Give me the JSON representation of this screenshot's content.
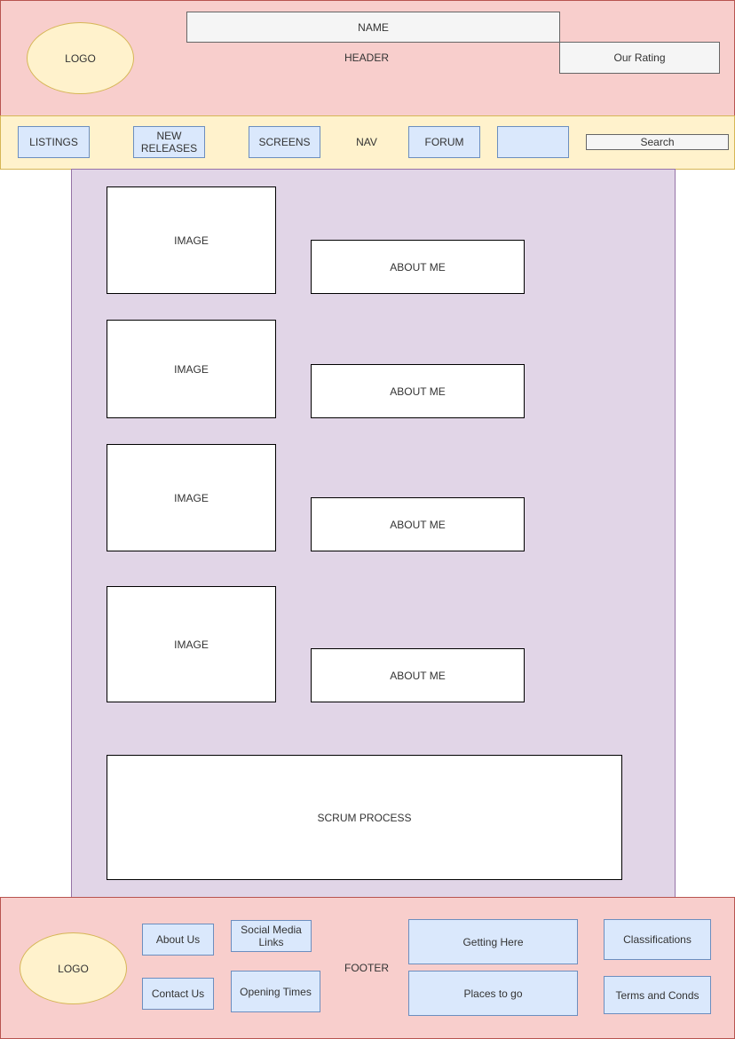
{
  "header": {
    "label": "HEADER",
    "logo": "LOGO",
    "name": "NAME",
    "rating": "Our Rating"
  },
  "nav": {
    "label": "NAV",
    "items": [
      "LISTINGS",
      "NEW\nRELEASES",
      "SCREENS",
      "FORUM",
      ""
    ],
    "search": "Search"
  },
  "main": {
    "rows": [
      {
        "image": "IMAGE",
        "about": "ABOUT ME"
      },
      {
        "image": "IMAGE",
        "about": "ABOUT ME"
      },
      {
        "image": "IMAGE",
        "about": "ABOUT ME"
      },
      {
        "image": "IMAGE",
        "about": "ABOUT ME"
      }
    ],
    "scrum": "SCRUM PROCESS"
  },
  "footer": {
    "label": "FOOTER",
    "logo": "LOGO",
    "about_us": "About Us",
    "social": "Social Media Links",
    "contact_us": "Contact Us",
    "opening_times": "Opening Times",
    "getting_here": "Getting Here",
    "places_to_go": "Places to go",
    "classifications": "Classifications",
    "terms": "Terms and Conds"
  },
  "colors": {
    "header_fill": "#f8cecc",
    "nav_fill": "#fff2cc",
    "main_fill": "#e1d5e7",
    "button_fill": "#dae8fc"
  }
}
